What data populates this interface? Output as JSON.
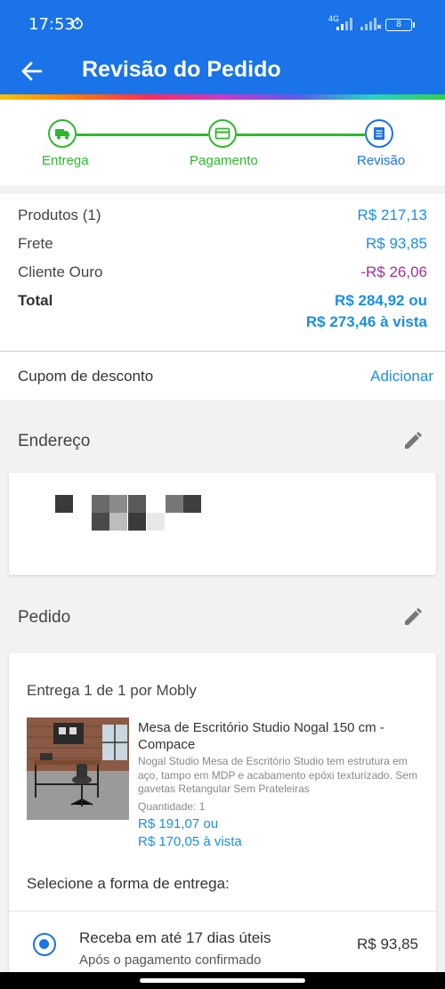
{
  "status_bar": {
    "time": "17:53",
    "network": "4G",
    "battery": "8",
    "icons": [
      "timer-icon",
      "signal-icon",
      "signal-off-icon",
      "battery-icon"
    ]
  },
  "app_bar": {
    "title": "Revisão do Pedido",
    "color": "#1a73e8"
  },
  "stepper": {
    "steps": [
      {
        "label": "Entrega",
        "icon": "truck-icon",
        "state": "completed"
      },
      {
        "label": "Pagamento",
        "icon": "credit-card-icon",
        "state": "completed"
      },
      {
        "label": "Revisão",
        "icon": "list-icon",
        "state": "current"
      }
    ],
    "completed_color": "#2eb82e",
    "current_color": "#1a73e8"
  },
  "summary": {
    "products_label": "Produtos (1)",
    "products_value": "R$ 217,13",
    "shipping_label": "Frete",
    "shipping_value": "R$ 93,85",
    "gold_label": "Cliente Ouro",
    "gold_value": "-R$ 26,06",
    "gold_color": "#a3319b",
    "total_label": "Total",
    "total_value_line1": "R$ 284,92 ou",
    "total_value_line2": "R$ 273,46 à vista"
  },
  "coupon": {
    "label": "Cupom de desconto",
    "action": "Adicionar"
  },
  "address": {
    "title": "Endereço"
  },
  "order": {
    "title": "Pedido",
    "shipment": "Entrega 1 de 1 por Mobly",
    "product": {
      "name": "Mesa de Escritório Studio Nogal 150 cm - Compace",
      "description": "Nogal Studio Mesa de Escritório Studio tem estrutura em aço, tampo em MDP e acabamento epóxi texturizado. Sem gavetas Retangular Sem Prateleiras",
      "quantity": "Quantidade:  1",
      "price": "R$ 191,07 ou",
      "price_cash": "R$ 170,05 à vista"
    },
    "delivery_prompt": "Selecione a forma de entrega:",
    "delivery_option": {
      "title": "Receba em até 17 dias úteis",
      "subtitle": "Após o pagamento confirmado",
      "price": "R$ 93,85",
      "selected": true
    }
  },
  "accent_color": "#1a8ee8"
}
